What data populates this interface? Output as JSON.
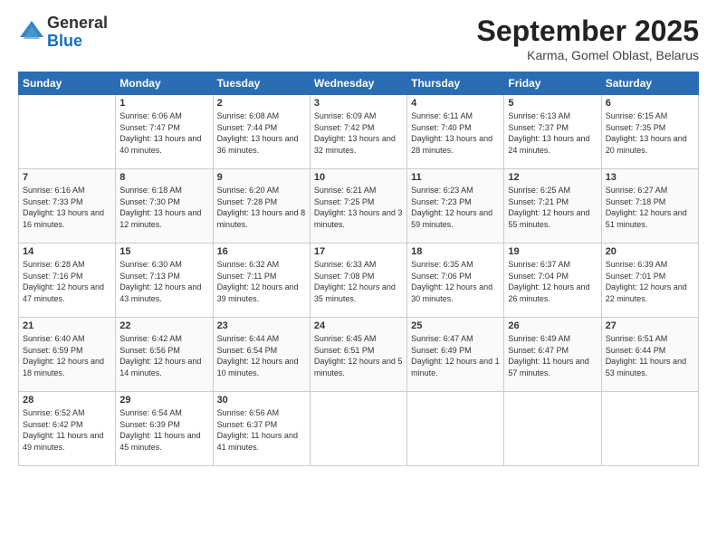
{
  "logo": {
    "general": "General",
    "blue": "Blue"
  },
  "header": {
    "title": "September 2025",
    "subtitle": "Karma, Gomel Oblast, Belarus"
  },
  "weekdays": [
    "Sunday",
    "Monday",
    "Tuesday",
    "Wednesday",
    "Thursday",
    "Friday",
    "Saturday"
  ],
  "weeks": [
    [
      {
        "day": "",
        "sunrise": "",
        "sunset": "",
        "daylight": ""
      },
      {
        "day": "1",
        "sunrise": "Sunrise: 6:06 AM",
        "sunset": "Sunset: 7:47 PM",
        "daylight": "Daylight: 13 hours and 40 minutes."
      },
      {
        "day": "2",
        "sunrise": "Sunrise: 6:08 AM",
        "sunset": "Sunset: 7:44 PM",
        "daylight": "Daylight: 13 hours and 36 minutes."
      },
      {
        "day": "3",
        "sunrise": "Sunrise: 6:09 AM",
        "sunset": "Sunset: 7:42 PM",
        "daylight": "Daylight: 13 hours and 32 minutes."
      },
      {
        "day": "4",
        "sunrise": "Sunrise: 6:11 AM",
        "sunset": "Sunset: 7:40 PM",
        "daylight": "Daylight: 13 hours and 28 minutes."
      },
      {
        "day": "5",
        "sunrise": "Sunrise: 6:13 AM",
        "sunset": "Sunset: 7:37 PM",
        "daylight": "Daylight: 13 hours and 24 minutes."
      },
      {
        "day": "6",
        "sunrise": "Sunrise: 6:15 AM",
        "sunset": "Sunset: 7:35 PM",
        "daylight": "Daylight: 13 hours and 20 minutes."
      }
    ],
    [
      {
        "day": "7",
        "sunrise": "Sunrise: 6:16 AM",
        "sunset": "Sunset: 7:33 PM",
        "daylight": "Daylight: 13 hours and 16 minutes."
      },
      {
        "day": "8",
        "sunrise": "Sunrise: 6:18 AM",
        "sunset": "Sunset: 7:30 PM",
        "daylight": "Daylight: 13 hours and 12 minutes."
      },
      {
        "day": "9",
        "sunrise": "Sunrise: 6:20 AM",
        "sunset": "Sunset: 7:28 PM",
        "daylight": "Daylight: 13 hours and 8 minutes."
      },
      {
        "day": "10",
        "sunrise": "Sunrise: 6:21 AM",
        "sunset": "Sunset: 7:25 PM",
        "daylight": "Daylight: 13 hours and 3 minutes."
      },
      {
        "day": "11",
        "sunrise": "Sunrise: 6:23 AM",
        "sunset": "Sunset: 7:23 PM",
        "daylight": "Daylight: 12 hours and 59 minutes."
      },
      {
        "day": "12",
        "sunrise": "Sunrise: 6:25 AM",
        "sunset": "Sunset: 7:21 PM",
        "daylight": "Daylight: 12 hours and 55 minutes."
      },
      {
        "day": "13",
        "sunrise": "Sunrise: 6:27 AM",
        "sunset": "Sunset: 7:18 PM",
        "daylight": "Daylight: 12 hours and 51 minutes."
      }
    ],
    [
      {
        "day": "14",
        "sunrise": "Sunrise: 6:28 AM",
        "sunset": "Sunset: 7:16 PM",
        "daylight": "Daylight: 12 hours and 47 minutes."
      },
      {
        "day": "15",
        "sunrise": "Sunrise: 6:30 AM",
        "sunset": "Sunset: 7:13 PM",
        "daylight": "Daylight: 12 hours and 43 minutes."
      },
      {
        "day": "16",
        "sunrise": "Sunrise: 6:32 AM",
        "sunset": "Sunset: 7:11 PM",
        "daylight": "Daylight: 12 hours and 39 minutes."
      },
      {
        "day": "17",
        "sunrise": "Sunrise: 6:33 AM",
        "sunset": "Sunset: 7:08 PM",
        "daylight": "Daylight: 12 hours and 35 minutes."
      },
      {
        "day": "18",
        "sunrise": "Sunrise: 6:35 AM",
        "sunset": "Sunset: 7:06 PM",
        "daylight": "Daylight: 12 hours and 30 minutes."
      },
      {
        "day": "19",
        "sunrise": "Sunrise: 6:37 AM",
        "sunset": "Sunset: 7:04 PM",
        "daylight": "Daylight: 12 hours and 26 minutes."
      },
      {
        "day": "20",
        "sunrise": "Sunrise: 6:39 AM",
        "sunset": "Sunset: 7:01 PM",
        "daylight": "Daylight: 12 hours and 22 minutes."
      }
    ],
    [
      {
        "day": "21",
        "sunrise": "Sunrise: 6:40 AM",
        "sunset": "Sunset: 6:59 PM",
        "daylight": "Daylight: 12 hours and 18 minutes."
      },
      {
        "day": "22",
        "sunrise": "Sunrise: 6:42 AM",
        "sunset": "Sunset: 6:56 PM",
        "daylight": "Daylight: 12 hours and 14 minutes."
      },
      {
        "day": "23",
        "sunrise": "Sunrise: 6:44 AM",
        "sunset": "Sunset: 6:54 PM",
        "daylight": "Daylight: 12 hours and 10 minutes."
      },
      {
        "day": "24",
        "sunrise": "Sunrise: 6:45 AM",
        "sunset": "Sunset: 6:51 PM",
        "daylight": "Daylight: 12 hours and 5 minutes."
      },
      {
        "day": "25",
        "sunrise": "Sunrise: 6:47 AM",
        "sunset": "Sunset: 6:49 PM",
        "daylight": "Daylight: 12 hours and 1 minute."
      },
      {
        "day": "26",
        "sunrise": "Sunrise: 6:49 AM",
        "sunset": "Sunset: 6:47 PM",
        "daylight": "Daylight: 11 hours and 57 minutes."
      },
      {
        "day": "27",
        "sunrise": "Sunrise: 6:51 AM",
        "sunset": "Sunset: 6:44 PM",
        "daylight": "Daylight: 11 hours and 53 minutes."
      }
    ],
    [
      {
        "day": "28",
        "sunrise": "Sunrise: 6:52 AM",
        "sunset": "Sunset: 6:42 PM",
        "daylight": "Daylight: 11 hours and 49 minutes."
      },
      {
        "day": "29",
        "sunrise": "Sunrise: 6:54 AM",
        "sunset": "Sunset: 6:39 PM",
        "daylight": "Daylight: 11 hours and 45 minutes."
      },
      {
        "day": "30",
        "sunrise": "Sunrise: 6:56 AM",
        "sunset": "Sunset: 6:37 PM",
        "daylight": "Daylight: 11 hours and 41 minutes."
      },
      {
        "day": "",
        "sunrise": "",
        "sunset": "",
        "daylight": ""
      },
      {
        "day": "",
        "sunrise": "",
        "sunset": "",
        "daylight": ""
      },
      {
        "day": "",
        "sunrise": "",
        "sunset": "",
        "daylight": ""
      },
      {
        "day": "",
        "sunrise": "",
        "sunset": "",
        "daylight": ""
      }
    ]
  ]
}
